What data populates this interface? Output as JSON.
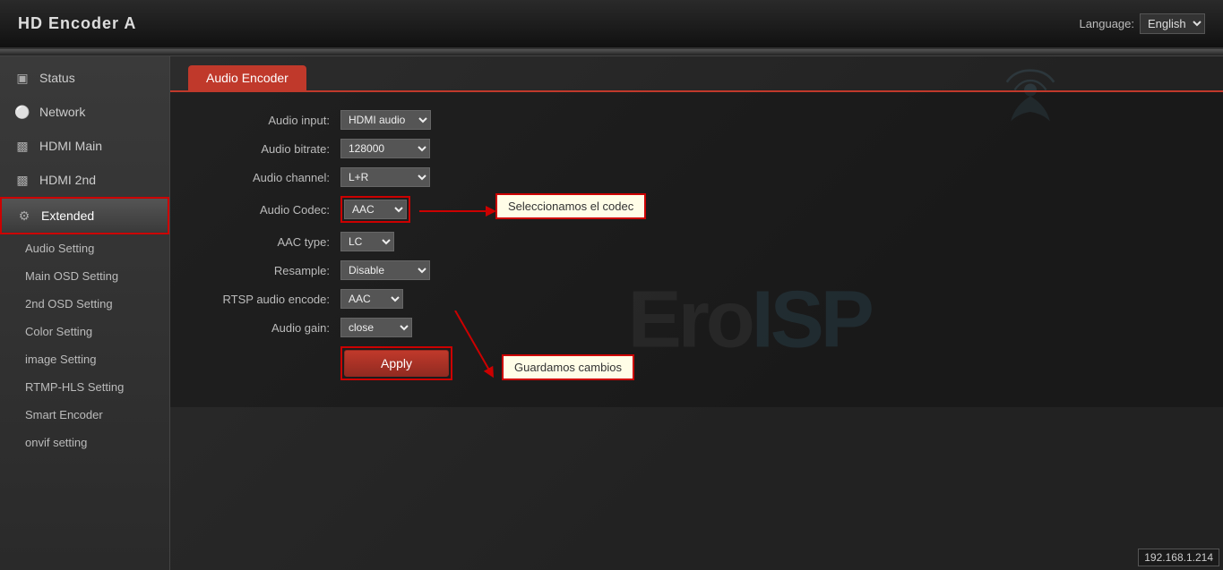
{
  "header": {
    "title": "HD Encoder  A",
    "language_label": "Language:",
    "language_value": "English"
  },
  "sidebar": {
    "items": [
      {
        "id": "status",
        "label": "Status",
        "icon": "monitor"
      },
      {
        "id": "network",
        "label": "Network",
        "icon": "globe"
      },
      {
        "id": "hdmi-main",
        "label": "HDMI Main",
        "icon": "screen"
      },
      {
        "id": "hdmi-2nd",
        "label": "HDMI 2nd",
        "icon": "screen"
      },
      {
        "id": "extended",
        "label": "Extended",
        "icon": "gear",
        "active": true
      }
    ],
    "sub_items": [
      "Audio Setting",
      "Main OSD Setting",
      "2nd OSD Setting",
      "Color Setting",
      "image Setting",
      "RTMP-HLS Setting",
      "Smart Encoder",
      "onvif setting"
    ]
  },
  "main": {
    "tab": "Audio Encoder",
    "form": {
      "audio_input_label": "Audio input:",
      "audio_input_value": "HDMI audio",
      "audio_bitrate_label": "Audio bitrate:",
      "audio_bitrate_value": "128000",
      "audio_channel_label": "Audio channel:",
      "audio_channel_value": "L+R",
      "audio_codec_label": "Audio Codec:",
      "audio_codec_value": "AAC",
      "aac_type_label": "AAC type:",
      "aac_type_value": "LC",
      "resample_label": "Resample:",
      "resample_value": "Disable",
      "rtsp_label": "RTSP audio encode:",
      "rtsp_value": "AAC",
      "audio_gain_label": "Audio gain:",
      "audio_gain_value": "close",
      "apply_label": "Apply"
    },
    "callout1": "Seleccionamos el codec",
    "callout2": "Guardamos cambios",
    "watermark": "EroISP",
    "ip": "192.168.1.214"
  }
}
